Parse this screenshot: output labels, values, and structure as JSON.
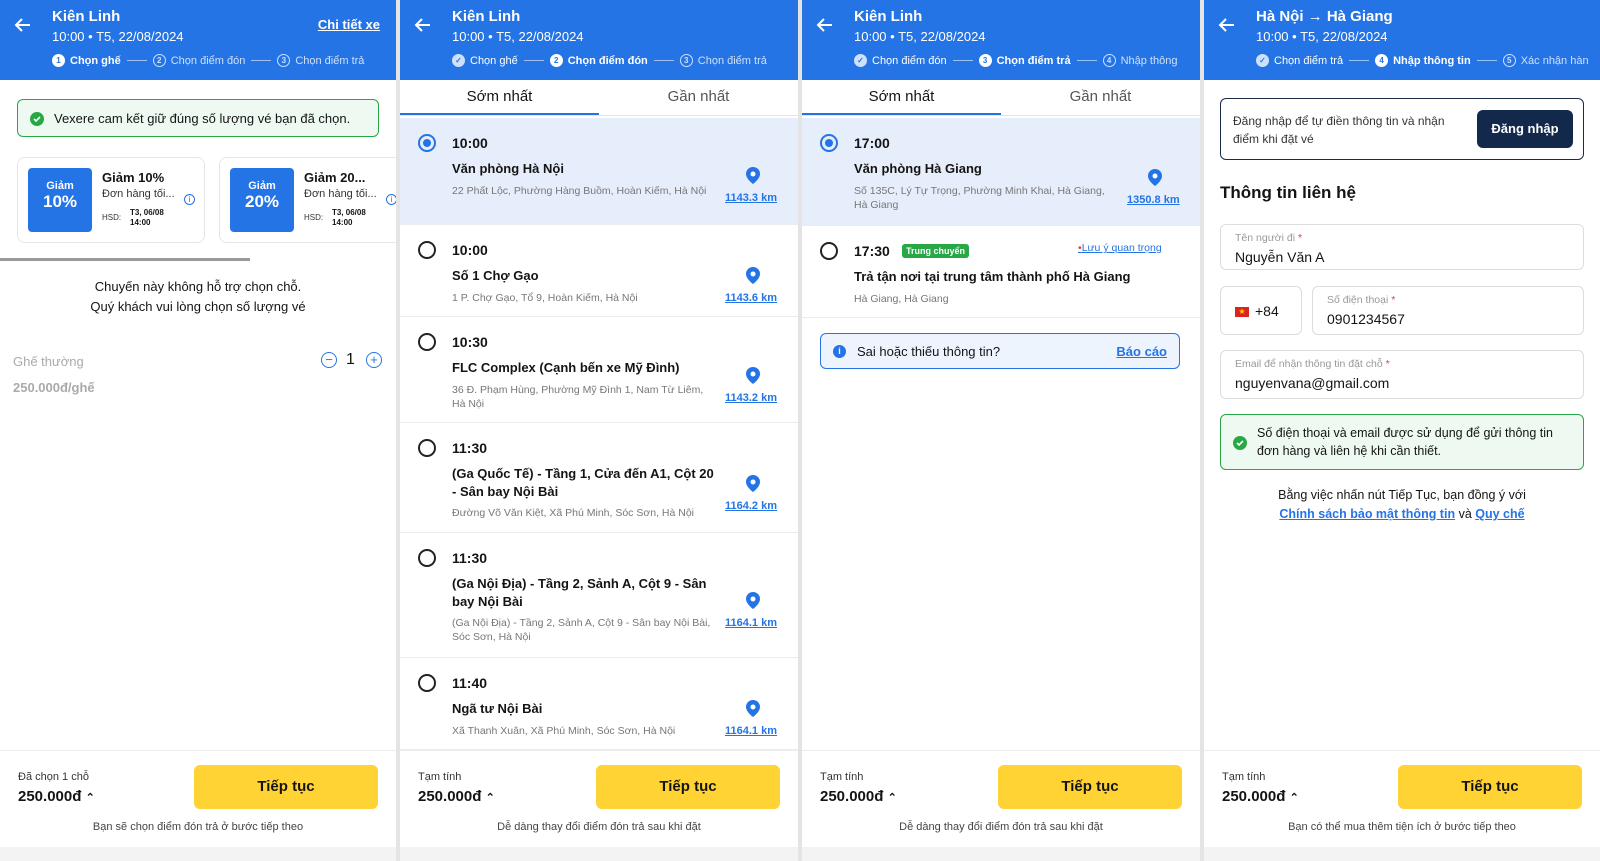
{
  "colors": {
    "primary": "#2474e5",
    "button": "#ffd333",
    "success": "#27a844"
  },
  "s1": {
    "title": "Kiên Linh",
    "subtitle": "10:00 • T5, 22/08/2024",
    "detail_link": "Chi tiết xe",
    "steps": [
      {
        "num": "1",
        "label": "Chọn ghế"
      },
      {
        "num": "2",
        "label": "Chọn điểm đón"
      },
      {
        "num": "3",
        "label": "Chọn điểm trả"
      }
    ],
    "guarantee": "Vexere cam kết giữ đúng số lượng vé bạn đã chọn.",
    "coupons": [
      {
        "img_top": "Giảm",
        "img_pct": "10%",
        "title": "Giảm 10%",
        "desc": "Đơn hàng tối...",
        "hsd": "HSD:",
        "date1": "T3, 06/08",
        "date2": "14:00"
      },
      {
        "img_top": "Giảm",
        "img_pct": "20%",
        "title": "Giảm 20...",
        "desc": "Đơn hàng tối...",
        "hsd": "HSD:",
        "date1": "T3, 06/08",
        "date2": "14:00"
      }
    ],
    "notice1": "Chuyến này không hỗ trợ chọn chỗ.",
    "notice2": "Quý khách vui lòng chọn số lượng vé",
    "seat_type": "Ghế thường",
    "seat_price": "250.000đ/ghế",
    "qty": "1",
    "footer": {
      "label": "Đã chọn 1 chỗ",
      "price": "250.000đ",
      "button": "Tiếp tục",
      "note": "Bạn sẽ chọn điểm đón trả ở bước tiếp theo"
    }
  },
  "s2": {
    "title": "Kiên Linh",
    "subtitle": "10:00 • T5, 22/08/2024",
    "steps": [
      {
        "num": "✓",
        "label": "Chọn ghế"
      },
      {
        "num": "2",
        "label": "Chọn điểm đón"
      },
      {
        "num": "3",
        "label": "Chọn điểm trả"
      }
    ],
    "tabs": [
      "Sớm nhất",
      "Gần nhất"
    ],
    "items": [
      {
        "time": "10:00",
        "name": "Văn phòng Hà Nội",
        "addr": "22 Phất Lộc, Phường Hàng Buồm, Hoàn Kiếm, Hà Nội",
        "dist": "1143.3 km",
        "selected": true
      },
      {
        "time": "10:00",
        "name": "Số 1 Chợ Gạo",
        "addr": "1 P. Chợ Gạo, Tổ 9, Hoàn Kiếm, Hà Nội",
        "dist": "1143.6 km",
        "selected": false
      },
      {
        "time": "10:30",
        "name": "FLC Complex (Cạnh bến xe Mỹ Đình)",
        "addr": "36 Đ. Phạm Hùng, Phường Mỹ Đình 1, Nam Từ Liêm, Hà Nội",
        "dist": "1143.2 km",
        "selected": false
      },
      {
        "time": "11:30",
        "name": "(Ga Quốc Tế) - Tầng 1, Cửa đến A1, Cột 20 - Sân bay Nội Bài",
        "addr": "Đường Võ Văn Kiệt, Xã Phú Minh, Sóc Sơn, Hà Nội",
        "dist": "1164.2 km",
        "selected": false
      },
      {
        "time": "11:30",
        "name": "(Ga Nội Địa) - Tầng 2, Sảnh A, Cột 9 - Sân bay Nội Bài",
        "addr": "(Ga Nội Địa) - Tầng 2, Sảnh A, Cột 9 - Sân bay Nội Bài, Sóc Sơn, Hà Nội",
        "dist": "1164.1 km",
        "selected": false
      },
      {
        "time": "11:40",
        "name": "Ngã tư Nội Bài",
        "addr": "Xã Thanh Xuân, Xã Phú Minh, Sóc Sơn, Hà Nội",
        "dist": "1164.1 km",
        "selected": false
      }
    ],
    "footer": {
      "label": "Tạm tính",
      "price": "250.000đ",
      "button": "Tiếp tục",
      "note": "Dễ dàng thay đổi điểm đón trả sau khi đặt"
    }
  },
  "s3": {
    "title": "Kiên Linh",
    "subtitle": "10:00 • T5, 22/08/2024",
    "steps": [
      {
        "num": "✓",
        "label": "Chọn điểm đón"
      },
      {
        "num": "3",
        "label": "Chọn điểm trả"
      },
      {
        "num": "4",
        "label": "Nhập thông"
      }
    ],
    "tabs": [
      "Sớm nhất",
      "Gần nhất"
    ],
    "items": [
      {
        "time": "17:00",
        "name": "Văn phòng Hà Giang",
        "addr": "Số 135C, Lý Tự Trọng, Phường Minh Khai, Hà Giang, Hà Giang",
        "dist": "1350.8 km",
        "selected": true
      },
      {
        "time": "17:30",
        "badge": "Trung chuyển",
        "note": "Lưu ý quan trọng",
        "name": "Trả tận nơi tại trung tâm thành phố Hà Giang",
        "addr": "Hà Giang, Hà Giang",
        "selected": false
      }
    ],
    "report_text": "Sai hoặc thiếu thông tin?",
    "report_link": "Báo cáo",
    "footer": {
      "label": "Tạm tính",
      "price": "250.000đ",
      "button": "Tiếp tục",
      "note": "Dễ dàng thay đổi điểm đón trả sau khi đặt"
    }
  },
  "s4": {
    "title": "Hà Nội → Hà Giang",
    "subtitle": "10:00 • T5, 22/08/2024",
    "steps": [
      {
        "num": "✓",
        "label": "Chọn điểm trả"
      },
      {
        "num": "4",
        "label": "Nhập thông tin"
      },
      {
        "num": "5",
        "label": "Xác nhận hàn"
      }
    ],
    "login_text": "Đăng nhập để tự điền thông tin và nhận điểm khi đặt vé",
    "login_button": "Đăng nhập",
    "section_title": "Thông tin liên hệ",
    "name_label": "Tên người đi",
    "name_value": "Nguyễn Văn A",
    "country_code": "+84",
    "phone_label": "Số điện thoại",
    "phone_value": "0901234567",
    "email_label": "Email để nhận thông tin đặt chỗ",
    "email_value": "nguyenvana@gmail.com",
    "info_text": "Số điện thoại và email được sử dụng để gửi thông tin đơn hàng và liên hệ khi cần thiết.",
    "agree_text": "Bằng việc nhấn nút Tiếp Tục, bạn đồng ý với",
    "policy_link": "Chính sách bảo mật thông tin",
    "and": "và",
    "rules_link": "Quy chế",
    "required_mark": "*",
    "footer": {
      "label": "Tạm tính",
      "price": "250.000đ",
      "button": "Tiếp tục",
      "note": "Bạn có thể mua thêm tiện ích ở bước tiếp theo"
    }
  }
}
